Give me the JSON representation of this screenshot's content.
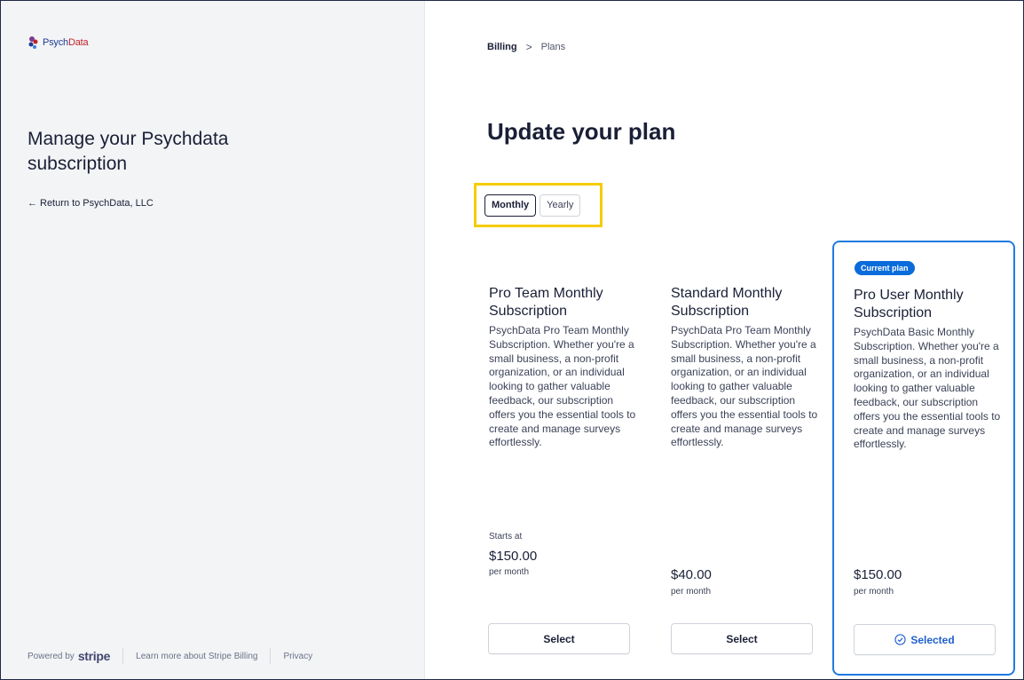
{
  "left": {
    "logo_prefix": "Psych",
    "logo_suffix": "Data",
    "title": "Manage your Psychdata subscription",
    "return_arrow": "←",
    "return_label": "Return to PsychData, LLC",
    "footer": {
      "powered_by": "Powered by",
      "stripe": "stripe",
      "learn_more": "Learn more about Stripe Billing",
      "privacy": "Privacy"
    }
  },
  "breadcrumb": {
    "billing": "Billing",
    "separator": ">",
    "plans": "Plans"
  },
  "page_title": "Update your plan",
  "interval_toggle": {
    "monthly": "Monthly",
    "yearly": "Yearly",
    "selected": "Monthly",
    "highlight_color": "#f5cc00"
  },
  "plans": [
    {
      "title": "Pro Team Monthly Subscription",
      "description": "PsychData Pro Team Monthly Subscription. Whether you're a small business, a non-profit organization, or an individual looking to gather valuable feedback, our subscription offers you the essential tools to create and manage surveys effortlessly.",
      "starts_at": "Starts at",
      "price": "$150.00",
      "period": "per month",
      "button": "Select"
    },
    {
      "title": "Standard Monthly Subscription",
      "description": "PsychData Pro Team Monthly Subscription. Whether you're a small business, a non-profit organization, or an individual looking to gather valuable feedback, our subscription offers you the essential tools to create and manage surveys effortlessly.",
      "price": "$40.00",
      "period": "per month",
      "button": "Select"
    },
    {
      "badge": "Current plan",
      "title": "Pro User Monthly Subscription",
      "description": "PsychData Basic Monthly Subscription. Whether you're a small business, a non-profit organization, or an individual looking to gather valuable feedback, our subscription offers you the essential tools to create and manage surveys effortlessly.",
      "price": "$150.00",
      "period": "per month",
      "button": "Selected"
    }
  ],
  "colors": {
    "accent": "#0a6cdb",
    "current_border": "#1f7ae0",
    "text_primary": "#1a1f36"
  }
}
